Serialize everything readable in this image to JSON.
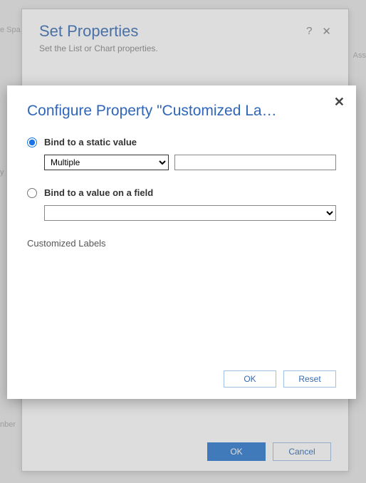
{
  "bg": {
    "title": "Set Properties",
    "subtitle": "Set the List or Chart properties.",
    "help_icon": "?",
    "close_icon": "✕",
    "ok_label": "OK",
    "cancel_label": "Cancel"
  },
  "fg": {
    "title": "Configure Property \"Customized La…",
    "close_icon": "✕",
    "option1_label": "Bind to a static value",
    "option1_select_value": "Multiple",
    "option1_text_value": "",
    "option2_label": "Bind to a value on a field",
    "option2_select_value": "",
    "desc_text": "Customized Labels",
    "ok_label": "OK",
    "reset_label": "Reset"
  },
  "bgnoise": {
    "left1": "e Spa",
    "left2": "y",
    "left3": "nber",
    "right1": "Ass"
  }
}
